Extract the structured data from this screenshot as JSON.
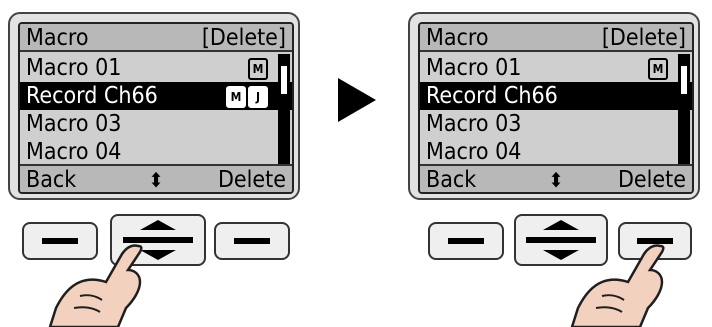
{
  "panels": [
    {
      "header": {
        "title": "Macro",
        "action": "[Delete]"
      },
      "items": [
        {
          "label": "Macro 01",
          "badges": [
            "M"
          ],
          "selected": false
        },
        {
          "label": "Record Ch66",
          "badges": [
            "M",
            "J"
          ],
          "selected": true
        },
        {
          "label": "Macro 03",
          "badges": [],
          "selected": false
        },
        {
          "label": "Macro 04",
          "badges": [],
          "selected": false
        }
      ],
      "footer": {
        "left": "Back",
        "center_icon": "up-down-arrows",
        "right": "Delete"
      }
    },
    {
      "header": {
        "title": "Macro",
        "action": "[Delete]"
      },
      "items": [
        {
          "label": "Macro 01",
          "badges": [
            "M"
          ],
          "selected": false
        },
        {
          "label": "Record Ch66",
          "badges": [],
          "selected": true
        },
        {
          "label": "Macro 03",
          "badges": [],
          "selected": false
        },
        {
          "label": "Macro 04",
          "badges": [],
          "selected": false
        }
      ],
      "footer": {
        "left": "Back",
        "center_icon": "up-down-arrows",
        "right": "Delete"
      }
    }
  ],
  "colors": {
    "screen": "#cfcfcf",
    "selection": "#000000",
    "device": "#e2e2e2"
  },
  "symbols": {
    "updown": "⬍"
  }
}
